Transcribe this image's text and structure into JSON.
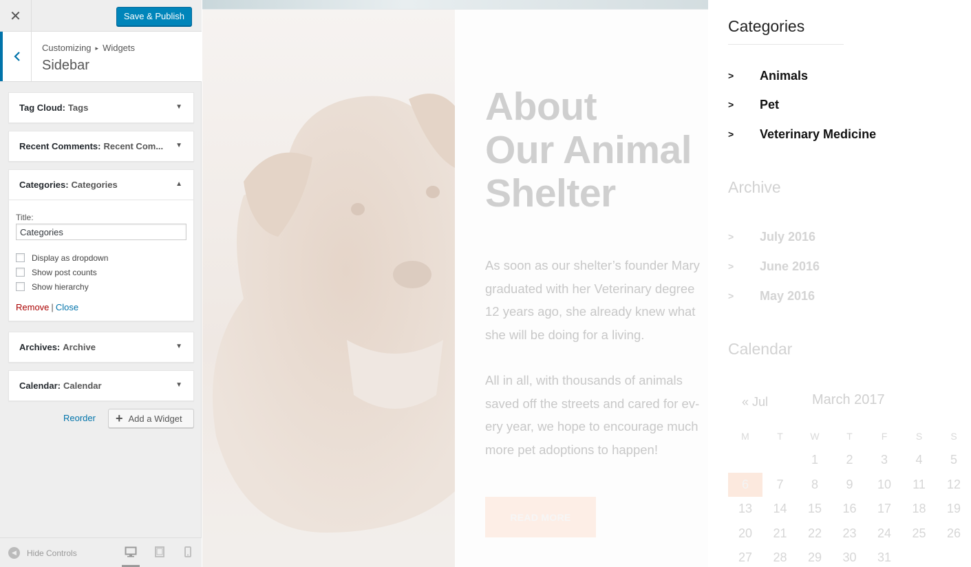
{
  "panel": {
    "close_glyph": "✕",
    "save_label": "Save & Publish",
    "breadcrumb": [
      "Customizing",
      "Widgets"
    ],
    "breadcrumb_sep": "▸",
    "section_title": "Sidebar",
    "widgets": [
      {
        "type": "Tag Cloud:",
        "instance": "Tags",
        "expanded": false
      },
      {
        "type": "Recent Comments:",
        "instance": "Recent Com...",
        "expanded": false
      },
      {
        "type": "Categories:",
        "instance": "Categories",
        "expanded": true
      },
      {
        "type": "Archives:",
        "instance": "Archive",
        "expanded": false
      },
      {
        "type": "Calendar:",
        "instance": "Calendar",
        "expanded": false
      }
    ],
    "form": {
      "title_label": "Title:",
      "title_value": "Categories",
      "checkboxes": [
        {
          "label": "Display as dropdown",
          "checked": false
        },
        {
          "label": "Show post counts",
          "checked": false
        },
        {
          "label": "Show hierarchy",
          "checked": false
        }
      ],
      "remove": "Remove",
      "pipe": "|",
      "close": "Close"
    },
    "reorder": "Reorder",
    "add_widget": "Add a Widget",
    "hide_controls": "Hide Controls",
    "devices": [
      "desktop",
      "tablet",
      "mobile"
    ],
    "active_device": "desktop",
    "accent": "#0085ba"
  },
  "preview": {
    "heading": [
      "About",
      "Our Animal",
      "Shelter"
    ],
    "para1": "As soon as our shelter’s founder Mary graduated with her Veterinary degree 12 years ago, she already knew what she will be doing for a living.",
    "para2": "All in all, with thousands of animals saved off the streets and cared for ev-ery year, we hope to encourage much more pet adoptions to happen!",
    "read_more": "READ MORE",
    "sidebar": {
      "categories_title": "Categories",
      "categories": [
        "Animals",
        "Pet",
        "Veterinary Medicine"
      ],
      "archive_title": "Archive",
      "archives": [
        "July 2016",
        "June 2016",
        "May 2016"
      ],
      "calendar_title": "Calendar",
      "calendar": {
        "prev": "« Jul",
        "month": "March 2017",
        "weekdays": [
          "M",
          "T",
          "W",
          "T",
          "F",
          "S",
          "S"
        ],
        "first_weekday_index": 2,
        "days_in_month": 31,
        "today": 6
      }
    },
    "accent": "#fce9de"
  }
}
